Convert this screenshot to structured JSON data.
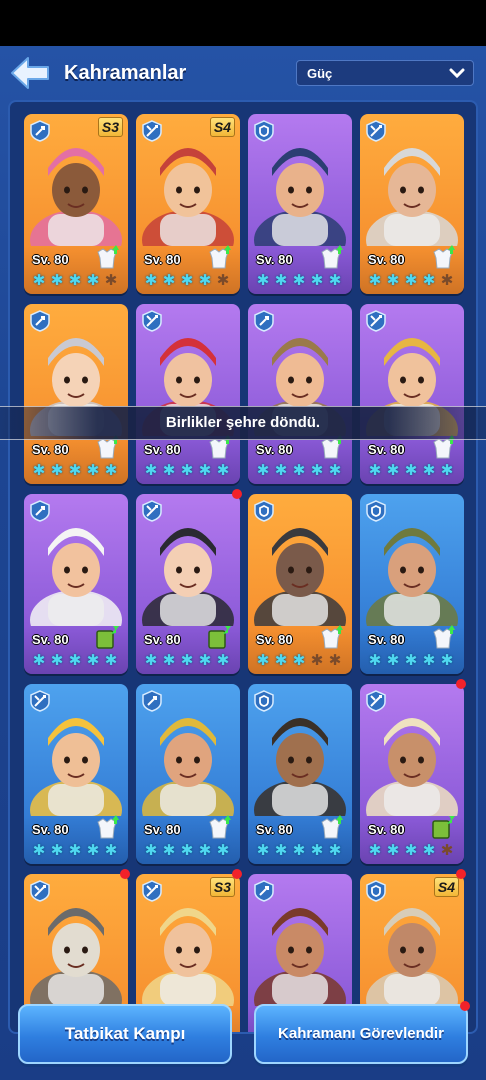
{
  "header": {
    "title": "Kahramanlar",
    "sort_value": "Güç"
  },
  "toast": "Birlikler şehre döndü.",
  "cards": [
    {
      "bg": "orange",
      "cls": "archer",
      "level": "Sv. 80",
      "season": "S3",
      "stars": 4,
      "gear": "white",
      "dot": false,
      "face": "#8b5a3a",
      "hat": "#e36fa5"
    },
    {
      "bg": "orange",
      "cls": "spear",
      "level": "Sv. 80",
      "season": "S4",
      "stars": 4,
      "gear": "white",
      "dot": false,
      "face": "#f1c39a",
      "hat": "#c5423a"
    },
    {
      "bg": "purple",
      "cls": "shield",
      "level": "Sv. 80",
      "season": "",
      "stars": 5,
      "gear": "white",
      "dot": false,
      "face": "#e9b28b",
      "hat": "#2b3e73"
    },
    {
      "bg": "orange",
      "cls": "spear",
      "level": "Sv. 80",
      "season": "",
      "stars": 4,
      "gear": "white",
      "dot": false,
      "face": "#e6b796",
      "hat": "#d8d8d8"
    },
    {
      "bg": "orange",
      "cls": "archer",
      "level": "Sv. 80",
      "season": "",
      "stars": 5,
      "gear": "white",
      "dot": false,
      "face": "#f5d3b7",
      "hat": "#c9c9d2"
    },
    {
      "bg": "purple",
      "cls": "spear",
      "level": "Sv. 80",
      "season": "",
      "stars": 5,
      "gear": "white",
      "dot": false,
      "face": "#f0c2a0",
      "hat": "#d4313a"
    },
    {
      "bg": "purple",
      "cls": "archer",
      "level": "Sv. 80",
      "season": "",
      "stars": 5,
      "gear": "white",
      "dot": false,
      "face": "#efbb94",
      "hat": "#9a7a4a"
    },
    {
      "bg": "purple",
      "cls": "spear",
      "level": "Sv. 80",
      "season": "",
      "stars": 5,
      "gear": "white",
      "dot": false,
      "face": "#f0c29c",
      "hat": "#e7b642"
    },
    {
      "bg": "purple",
      "cls": "archer",
      "level": "Sv. 80",
      "season": "",
      "stars": 5,
      "gear": "green",
      "dot": false,
      "face": "#f2c29e",
      "hat": "#f4f4f4"
    },
    {
      "bg": "purple",
      "cls": "spear",
      "level": "Sv. 80",
      "season": "",
      "stars": 5,
      "gear": "green",
      "dot": true,
      "face": "#f4cfb4",
      "hat": "#2a2a32"
    },
    {
      "bg": "orange",
      "cls": "shield",
      "level": "Sv. 80",
      "season": "",
      "stars": 3,
      "gear": "white",
      "dot": false,
      "face": "#7a5a4a",
      "hat": "#3a3a3e"
    },
    {
      "bg": "blue",
      "cls": "shield",
      "level": "Sv. 80",
      "season": "",
      "stars": 5,
      "gear": "white",
      "dot": false,
      "face": "#d9a07c",
      "hat": "#6f7a3e"
    },
    {
      "bg": "blue",
      "cls": "spear",
      "level": "Sv. 80",
      "season": "",
      "stars": 5,
      "gear": "white",
      "dot": false,
      "face": "#efbf96",
      "hat": "#f5c23c"
    },
    {
      "bg": "blue",
      "cls": "archer",
      "level": "Sv. 80",
      "season": "",
      "stars": 5,
      "gear": "white",
      "dot": false,
      "face": "#e0a47e",
      "hat": "#e0b93a"
    },
    {
      "bg": "blue",
      "cls": "shield",
      "level": "Sv. 80",
      "season": "",
      "stars": 5,
      "gear": "white",
      "dot": false,
      "face": "#a0704e",
      "hat": "#3a3028"
    },
    {
      "bg": "purple",
      "cls": "spear",
      "level": "Sv. 80",
      "season": "",
      "stars": 4,
      "gear": "green",
      "dot": true,
      "face": "#c8906a",
      "hat": "#efe2c0"
    },
    {
      "bg": "orange",
      "cls": "spear",
      "level": "",
      "season": "",
      "stars": 0,
      "gear": "",
      "dot": true,
      "face": "#e2dcd0",
      "hat": "#6b6b6b"
    },
    {
      "bg": "orange",
      "cls": "spear",
      "level": "",
      "season": "S3",
      "stars": 0,
      "gear": "",
      "dot": true,
      "face": "#f0c29c",
      "hat": "#f0d68a"
    },
    {
      "bg": "purple",
      "cls": "archer",
      "level": "",
      "season": "",
      "stars": 0,
      "gear": "",
      "dot": false,
      "face": "#c98a66",
      "hat": "#7a3a2a"
    },
    {
      "bg": "orange",
      "cls": "shield",
      "level": "",
      "season": "S4",
      "stars": 0,
      "gear": "",
      "dot": true,
      "face": "#c08868",
      "hat": "#d8cdb8"
    }
  ],
  "buttons": {
    "left": "Tatbikat Kampı",
    "right": "Kahramanı Görevlendir"
  }
}
